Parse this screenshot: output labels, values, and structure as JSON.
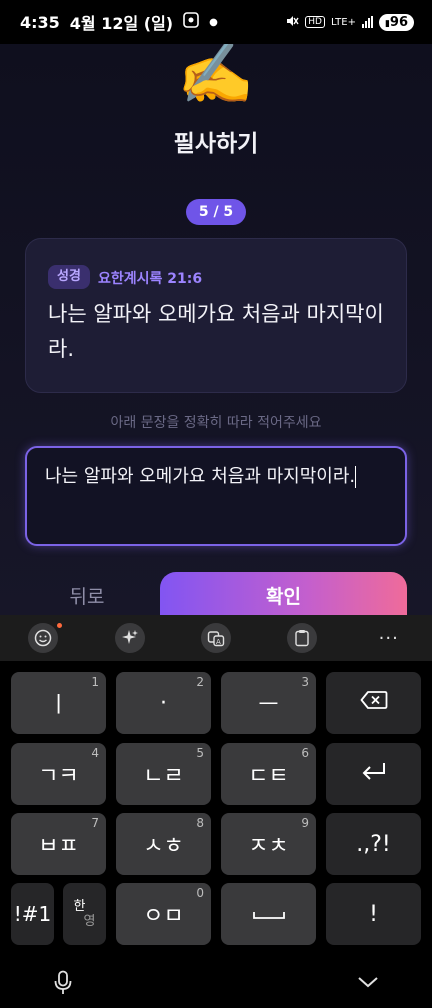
{
  "status_bar": {
    "time": "4:35",
    "date": "4월 12일 (일)",
    "network": "LTE+",
    "hd": "HD",
    "battery": "96"
  },
  "app": {
    "emoji": "✍️",
    "title": "필사하기",
    "progress": "5 / 5",
    "verse": {
      "tag": "성경",
      "reference": "요한계시록 21:6",
      "text": "나는 알파와 오메가요 처음과 마지막이라."
    },
    "instruction": "아래 문장을 정확히 따라 적어주세요",
    "input_value": "나는 알파와 오메가요 처음과 마지막이라.",
    "back_label": "뒤로",
    "confirm_label": "확인"
  },
  "keyboard": {
    "toolbar": [
      "emoji-icon",
      "sparkle-icon",
      "translate-icon",
      "clipboard-icon",
      "more-icon"
    ],
    "rows": [
      [
        {
          "label": "ㅣ",
          "hint": "1"
        },
        {
          "label": "·",
          "hint": "2"
        },
        {
          "label": "ㅡ",
          "hint": "3"
        },
        {
          "label": "backspace",
          "hint": ""
        }
      ],
      [
        {
          "label": "ㄱㅋ",
          "hint": "4"
        },
        {
          "label": "ㄴㄹ",
          "hint": "5"
        },
        {
          "label": "ㄷㅌ",
          "hint": "6"
        },
        {
          "label": "enter",
          "hint": ""
        }
      ],
      [
        {
          "label": "ㅂㅍ",
          "hint": "7"
        },
        {
          "label": "ㅅㅎ",
          "hint": "8"
        },
        {
          "label": "ㅈㅊ",
          "hint": "9"
        },
        {
          "label": ".,?!",
          "hint": ""
        }
      ],
      [
        {
          "label": "!#1",
          "hint": ""
        },
        {
          "label": "한/영",
          "hint": ""
        },
        {
          "label": "ㅇㅁ",
          "hint": "0"
        },
        {
          "label": "space",
          "hint": ""
        },
        {
          "label": "!",
          "hint": ""
        }
      ]
    ],
    "keys": {
      "k1": "ㅣ",
      "k1h": "1",
      "k2": "·",
      "k2h": "2",
      "k3": "ㅡ",
      "k3h": "3",
      "k4": "ㄱㅋ",
      "k4h": "4",
      "k5": "ㄴㄹ",
      "k5h": "5",
      "k6": "ㄷㅌ",
      "k6h": "6",
      "k7": "ㅂㅍ",
      "k7h": "7",
      "k8": "ㅅㅎ",
      "k8h": "8",
      "k9": "ㅈㅊ",
      "k9h": "9",
      "punct": ".,?!",
      "sym": "!#1",
      "lang_top": "한",
      "lang_bottom": "영",
      "k0": "ㅇㅁ",
      "k0h": "0",
      "excl": "!"
    }
  },
  "colors": {
    "accent": "#6f55e8",
    "confirm_gradient_start": "#8255f2",
    "confirm_gradient_end": "#ef6b9a",
    "card_bg": "#1e1d35",
    "key_bg": "#3a3a3c"
  }
}
